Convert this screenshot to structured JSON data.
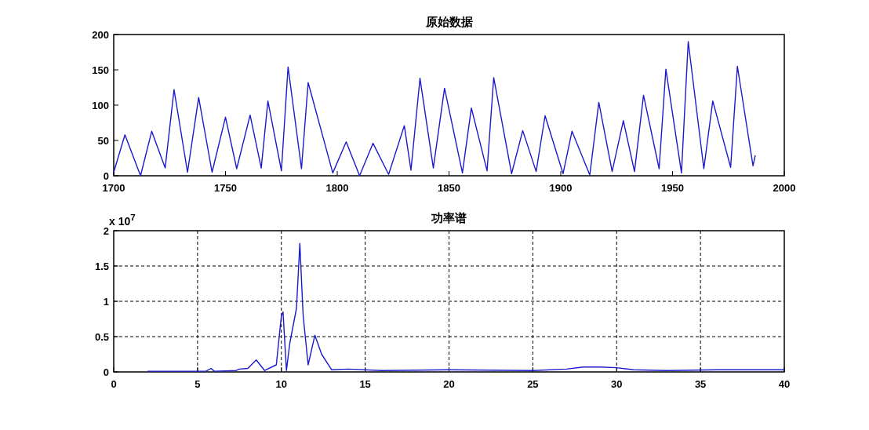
{
  "panels": [
    {
      "chart_data": {
        "type": "line",
        "grid": false,
        "title": "原始数据",
        "xlim": [
          1700,
          2000
        ],
        "ylim": [
          0,
          200
        ],
        "xticks": [
          1700,
          1750,
          1800,
          1850,
          1900,
          1950,
          2000
        ],
        "yticks": [
          0,
          50,
          100,
          150,
          200
        ],
        "x": [
          1700,
          1705,
          1712,
          1717,
          1723,
          1727,
          1733,
          1738,
          1744,
          1750,
          1755,
          1761,
          1766,
          1769,
          1775,
          1778,
          1784,
          1787,
          1798,
          1804,
          1810,
          1816,
          1823,
          1830,
          1833,
          1837,
          1843,
          1848,
          1856,
          1860,
          1867,
          1870,
          1878,
          1883,
          1889,
          1893,
          1901,
          1905,
          1913,
          1917,
          1923,
          1928,
          1933,
          1937,
          1944,
          1947,
          1954,
          1957,
          1964,
          1968,
          1976,
          1979,
          1986,
          1987
        ],
        "series": [
          {
            "color": "#1a1acc",
            "values": [
              5,
              58,
              0,
              63,
              11,
              122,
              5,
              111,
              5,
              83,
              10,
              86,
              11,
              106,
              7,
              154,
              10,
              132,
              4,
              48,
              0,
              46,
              2,
              71,
              8,
              138,
              11,
              124,
              4,
              96,
              7,
              139,
              3,
              64,
              6,
              85,
              3,
              63,
              1,
              104,
              6,
              78,
              6,
              114,
              10,
              151,
              4,
              190,
              10,
              106,
              12,
              155,
              14,
              29
            ]
          }
        ]
      }
    },
    {
      "y_multiplier": "x 10$^{7}$",
      "chart_data": {
        "type": "line",
        "grid": true,
        "title": "功率谱",
        "xlim": [
          0,
          40
        ],
        "ylim": [
          0,
          2
        ],
        "xticks": [
          0,
          5,
          10,
          15,
          20,
          25,
          30,
          35,
          40
        ],
        "yticks": [
          0,
          0.5,
          1,
          1.5,
          2
        ],
        "x": [
          2,
          5.5,
          5.8,
          6,
          7.3,
          7.5,
          8,
          8.5,
          9,
          9.7,
          10,
          10.1,
          10.3,
          10.5,
          10.9,
          11.1,
          11.3,
          11.6,
          12,
          12.4,
          13,
          14,
          16,
          20,
          25,
          27,
          28,
          29,
          30,
          31,
          33,
          36,
          40
        ],
        "series": [
          {
            "color": "#1a1acc",
            "values": [
              0.01,
              0.01,
              0.05,
              0.01,
              0.02,
              0.04,
              0.05,
              0.17,
              0.02,
              0.1,
              0.8,
              0.85,
              0.02,
              0.4,
              0.9,
              1.82,
              0.8,
              0.1,
              0.52,
              0.25,
              0.03,
              0.04,
              0.02,
              0.03,
              0.02,
              0.04,
              0.07,
              0.07,
              0.06,
              0.03,
              0.02,
              0.03,
              0.03
            ]
          }
        ]
      }
    }
  ]
}
